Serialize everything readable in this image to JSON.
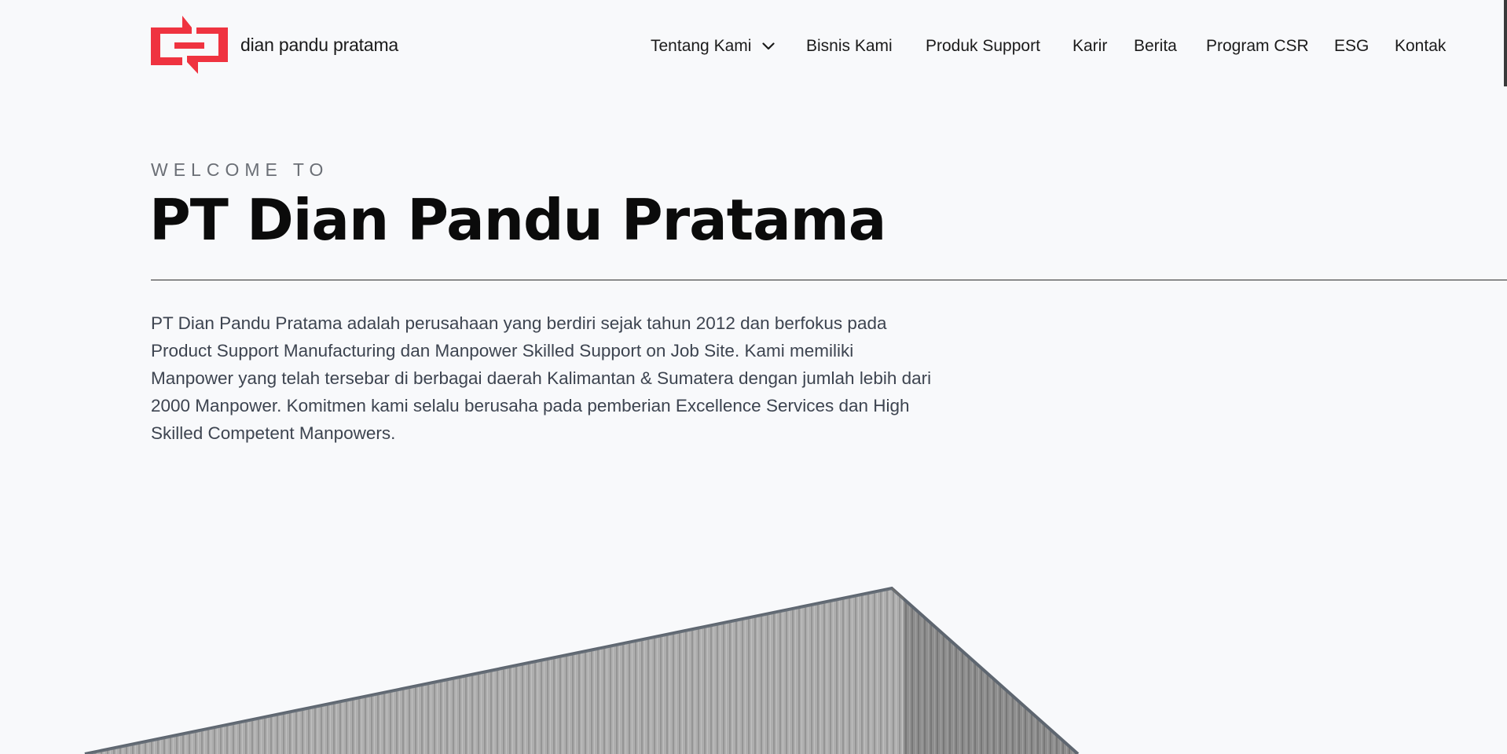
{
  "brand": {
    "name": "dian pandu pratama",
    "accent_color": "#ef3340"
  },
  "nav": {
    "items": [
      {
        "label": "Tentang Kami",
        "has_dropdown": true
      },
      {
        "label": "Bisnis Kami"
      },
      {
        "label": "Produk Support"
      },
      {
        "label": "Karir"
      },
      {
        "label": "Berita"
      },
      {
        "label": "Program CSR"
      },
      {
        "label": "ESG"
      },
      {
        "label": "Kontak"
      }
    ]
  },
  "hero": {
    "eyebrow": "WELCOME TO",
    "title": "PT Dian Pandu Pratama",
    "description": "PT Dian Pandu Pratama adalah perusahaan yang berdiri sejak tahun 2012 dan berfokus pada Product Support Manufacturing dan Manpower Skilled Support on Job Site. Kami memiliki Manpower yang telah tersebar di berbagai daerah Kalimantan & Sumatera dengan jumlah lebih dari 2000 Manpower. Komitmen kami selalu berusaha pada pemberian Excellence Services dan High Skilled Competent Manpowers."
  }
}
